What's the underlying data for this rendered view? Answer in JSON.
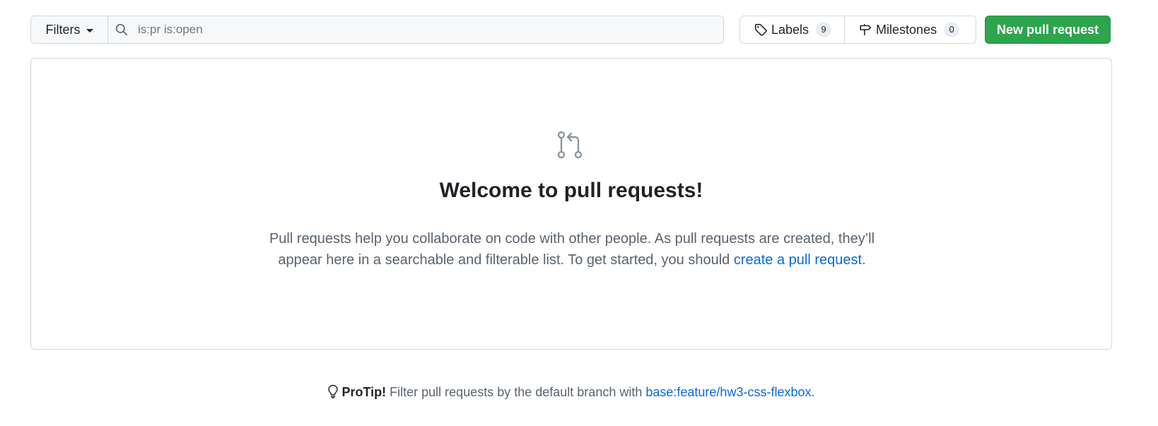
{
  "toolbar": {
    "filters_label": "Filters",
    "search_placeholder": "is:pr is:open",
    "search_value": "",
    "labels_label": "Labels",
    "labels_count": "9",
    "milestones_label": "Milestones",
    "milestones_count": "0",
    "new_pr_label": "New pull request"
  },
  "blankslate": {
    "icon": "git-pull-request-icon",
    "title": "Welcome to pull requests!",
    "description_part1": "Pull requests help you collaborate on code with other people. As pull requests are created, they’ll appear here in a searchable and filterable list. To get started, you should ",
    "link_text": "create a pull request",
    "description_part2": "."
  },
  "protip": {
    "icon": "light-bulb-icon",
    "label": "ProTip!",
    "text": " Filter pull requests by the default branch with ",
    "link_text": "base:feature/hw3-css-flexbox",
    "end": "."
  },
  "colors": {
    "accent_green": "#2da44e",
    "link_blue": "#0969da",
    "border": "#d0d7de",
    "muted_text": "#59636e"
  }
}
